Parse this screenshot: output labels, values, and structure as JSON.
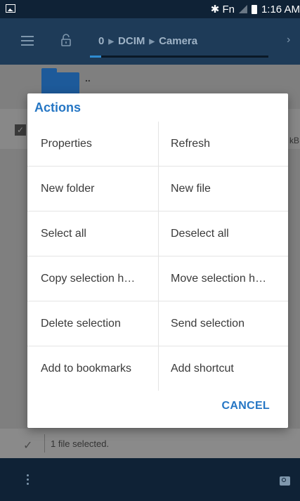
{
  "statusbar": {
    "icons": "✱ Fn",
    "time": "1:16 AM"
  },
  "appbar": {
    "menu_icon": "menu-icon",
    "lock_icon": "lock-icon",
    "crumbs": [
      "0",
      "DCIM",
      "Camera"
    ],
    "forward_icon": "chevron-right-icon"
  },
  "background": {
    "parent_label": "..",
    "file_size_fragment": "kB",
    "selection_text": "1 file selected."
  },
  "dialog": {
    "title": "Actions",
    "rows": [
      [
        "Properties",
        "Refresh"
      ],
      [
        "New folder",
        "New file"
      ],
      [
        "Select all",
        "Deselect all"
      ],
      [
        "Copy selection h…",
        "Move selection h…"
      ],
      [
        "Delete selection",
        "Send selection"
      ],
      [
        "Add to bookmarks",
        "Add shortcut"
      ]
    ],
    "cancel_label": "CANCEL"
  },
  "colors": {
    "accent": "#2576c4",
    "appbar": "#1e3b58",
    "statusbar": "#0f2236"
  }
}
